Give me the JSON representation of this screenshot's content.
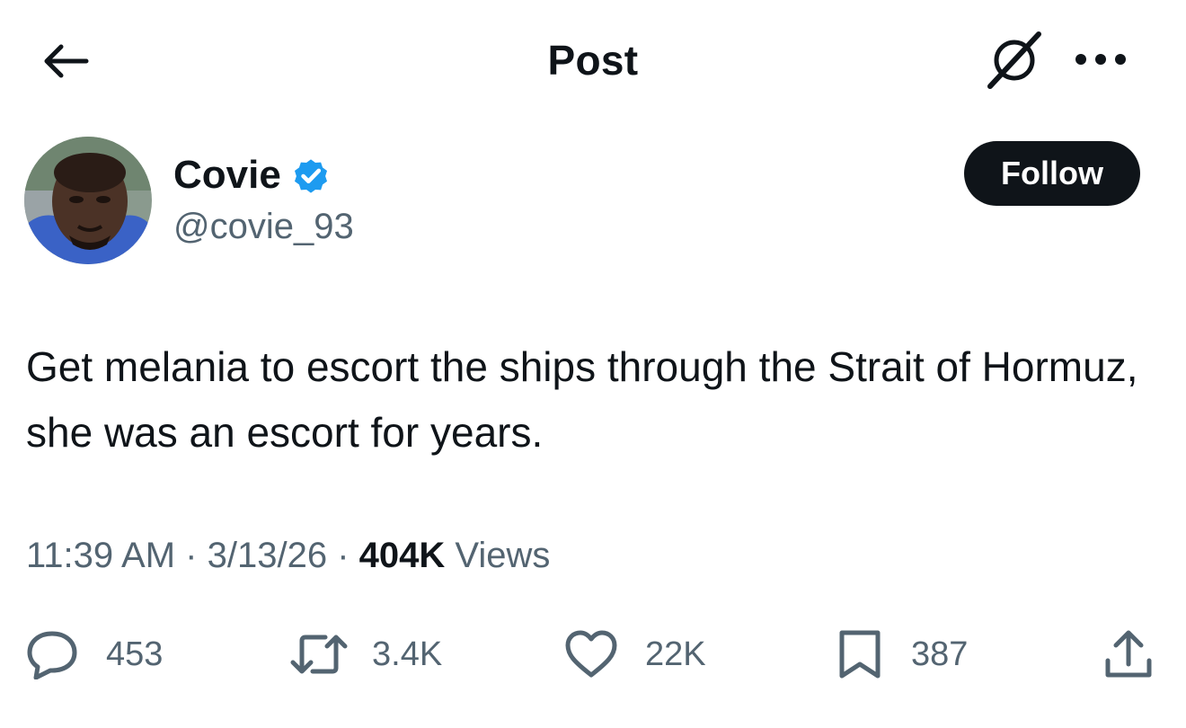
{
  "header": {
    "title": "Post",
    "back_icon": "arrow-left-icon",
    "grok_icon": "grok-icon",
    "more_icon": "more-dots-icon"
  },
  "author": {
    "display_name": "Covie",
    "handle": "@covie_93",
    "verified": true,
    "verified_color": "#1d9bf0"
  },
  "follow_label": "Follow",
  "post": {
    "text": "Get melania to escort the ships through the Strait of Hormuz, she was an escort for years."
  },
  "meta": {
    "time": "11:39 AM",
    "separator": "·",
    "date": "3/13/26",
    "views_count": "404K",
    "views_label": "Views"
  },
  "actions": {
    "replies": "453",
    "reposts": "3.4K",
    "likes": "22K",
    "bookmarks": "387"
  },
  "colors": {
    "text_primary": "#0f1419",
    "text_secondary": "#536471",
    "accent": "#1d9bf0",
    "button_bg": "#0f1419"
  }
}
